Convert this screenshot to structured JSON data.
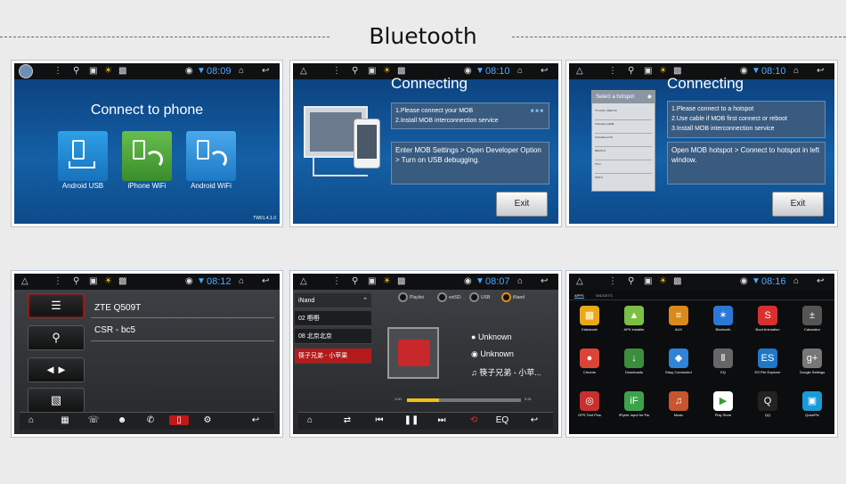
{
  "page_title": "Bluetooth",
  "colors": {
    "status_blue": "#4fa8ff",
    "screen_blue": "#1460a6",
    "active_red": "#c01818",
    "progress_yellow": "#f2c014"
  },
  "screens": {
    "connect": {
      "time": "08:09",
      "title": "Connect to phone",
      "tiles": [
        {
          "label": "Android USB",
          "color": "#1f87d1"
        },
        {
          "label": "iPhone WiFi",
          "color": "#4faa3a"
        },
        {
          "label": "Android WiFi",
          "color": "#2b8fd6"
        }
      ],
      "version": "TW01.4.1.0"
    },
    "usb": {
      "time": "08:10",
      "title": "Connecting",
      "steps": [
        "1.Please connect your MOB",
        "2.Install MOB interconnection service"
      ],
      "instruction": "Enter MOB Settings > Open Developer Option > Turn on USB debugging.",
      "exit": "Exit"
    },
    "hotspot": {
      "time": "08:10",
      "title": "Connecting",
      "popup_title": "Select a hotspot",
      "hotspots": [
        "TP-LINK_5DE7C8",
        "ChinaNet-QE9B",
        "ChinaNet-1710",
        "BEKSTU",
        "TP-2",
        "CMCC"
      ],
      "steps": [
        "1.Please connect to a hotspot",
        "2.Use cable if MOB first connect or reboot",
        "3.Install MOB interconnection service"
      ],
      "instruction": "Open MOB hotspot > Connect to hotspot in left window.",
      "exit": "Exit"
    },
    "phone": {
      "time": "08:12",
      "devices": [
        "ZTE Q509T",
        "CSR - bc5"
      ]
    },
    "music": {
      "time": "08:07",
      "source_title": "iNand",
      "playlist": [
        "02 嘢嘢",
        "08 北京北京",
        "筷子兄弟 - 小苹果"
      ],
      "sources": [
        "Playlist",
        "extSD",
        "USB",
        "iNand"
      ],
      "artist": "Unknown",
      "album": "Unknown",
      "song": "筷子兄弟 - 小苹...",
      "time_start": "1:00",
      "time_end": "3:31",
      "progress": 0.28,
      "eq": "EQ"
    },
    "apps": {
      "time": "08:16",
      "tabs": [
        "APPS",
        "WIDGETS"
      ],
      "items": [
        {
          "label": "Kidsmode",
          "color": "#e8a81a",
          "glyph": "▦"
        },
        {
          "label": "APK installer",
          "color": "#7bc043",
          "glyph": "▲"
        },
        {
          "label": "AUX",
          "color": "#d98a1b",
          "glyph": "≡"
        },
        {
          "label": "Bluetooth",
          "color": "#2a78d6",
          "glyph": "✶"
        },
        {
          "label": "Boot Animation",
          "color": "#d83030",
          "glyph": "S"
        },
        {
          "label": "Calculator",
          "color": "#555555",
          "glyph": "±"
        },
        {
          "label": "Chrome",
          "color": "#db4437",
          "glyph": "●"
        },
        {
          "label": "Downloads",
          "color": "#3b8e3b",
          "glyph": "↓"
        },
        {
          "label": "Easy Connected",
          "color": "#2f83d8",
          "glyph": "◆"
        },
        {
          "label": "EQ",
          "color": "#666666",
          "glyph": "Ⅱ"
        },
        {
          "label": "ES File Explorer",
          "color": "#1e78c8",
          "glyph": "ES"
        },
        {
          "label": "Google Settings",
          "color": "#777777",
          "glyph": "g+"
        },
        {
          "label": "GPS Test Plus",
          "color": "#c82f2f",
          "glyph": "◎"
        },
        {
          "label": "iFlytek Input for Pad",
          "color": "#3ca34a",
          "glyph": "iF"
        },
        {
          "label": "Music",
          "color": "#c8552f",
          "glyph": "♫"
        },
        {
          "label": "Play Store",
          "color": "#ffffff",
          "glyph": "▶"
        },
        {
          "label": "QQ",
          "color": "#222222",
          "glyph": "Q"
        },
        {
          "label": "QuickPic",
          "color": "#1a9ad6",
          "glyph": "▣"
        }
      ]
    }
  }
}
